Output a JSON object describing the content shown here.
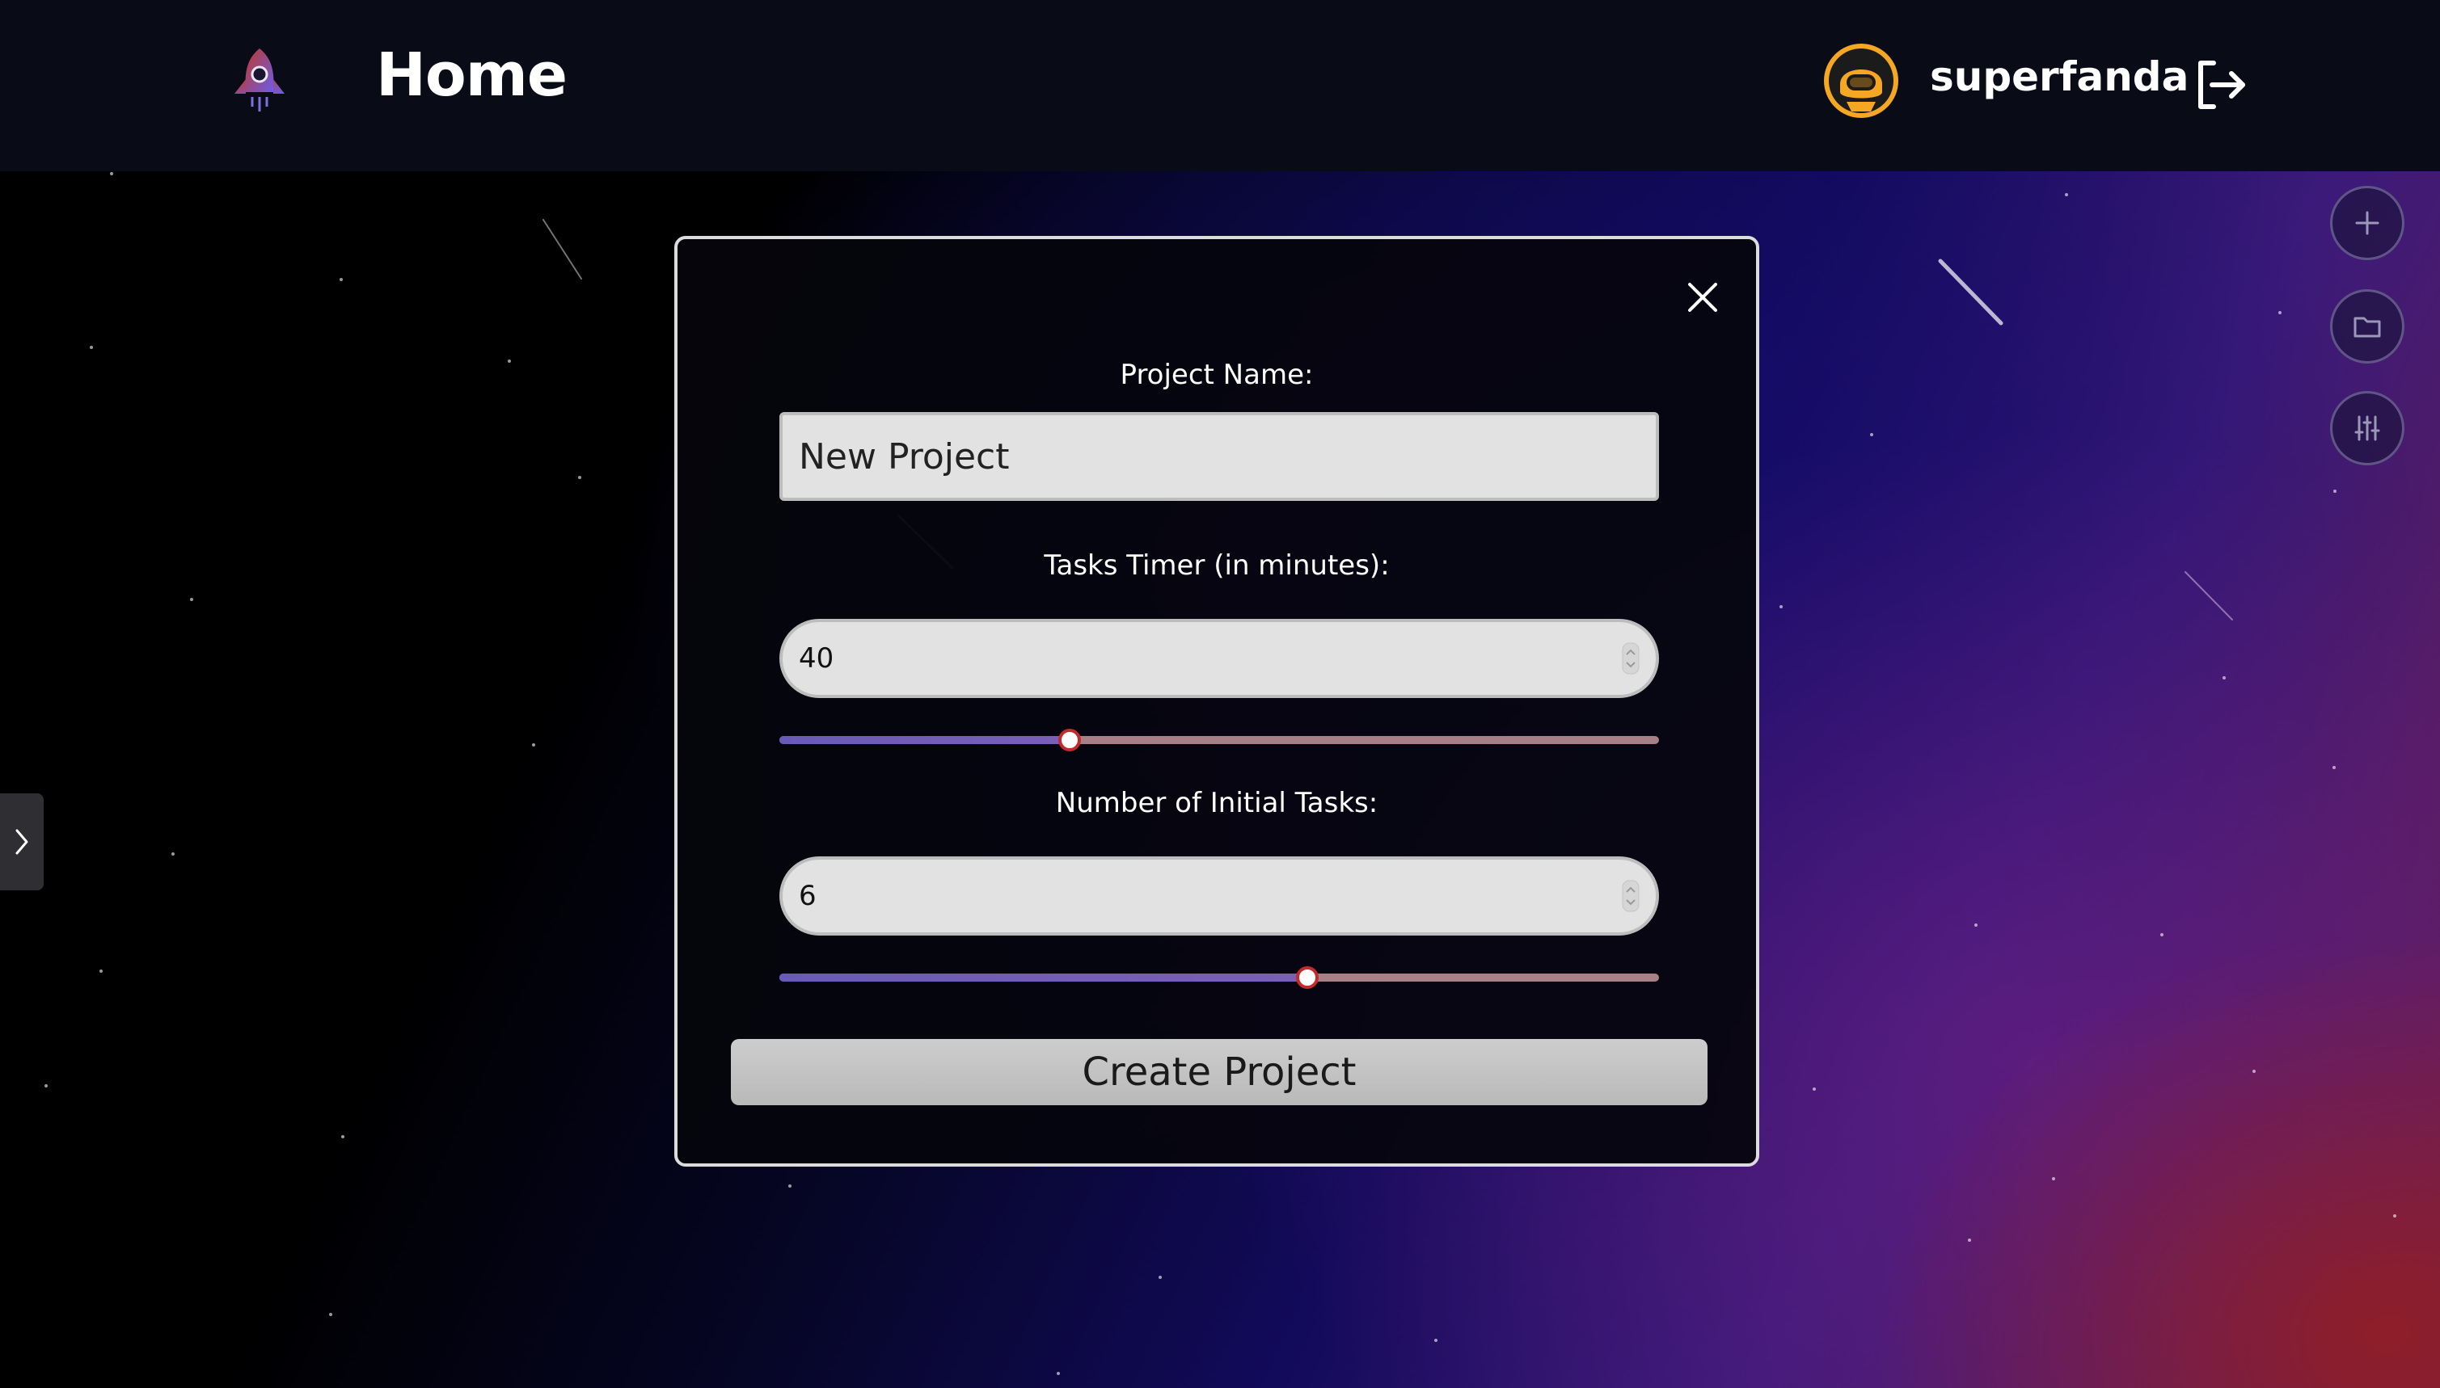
{
  "header": {
    "title": "Home",
    "username": "superfanda",
    "logo_icon": "rocket-icon",
    "avatar_icon": "astronaut-avatar-icon",
    "logout_icon": "logout-icon"
  },
  "side_actions": [
    {
      "icon": "plus-icon"
    },
    {
      "icon": "folder-icon"
    },
    {
      "icon": "sliders-icon"
    }
  ],
  "sidebar_toggle": {
    "icon": "chevron-right-icon"
  },
  "modal": {
    "project_name_label": "Project Name:",
    "project_name_value": "New Project",
    "tasks_timer_label": "Tasks Timer (in minutes):",
    "tasks_timer_value": "40",
    "tasks_timer_slider_fraction": 0.33,
    "initial_tasks_label": "Number of Initial Tasks:",
    "initial_tasks_value": "6",
    "initial_tasks_slider_fraction": 0.6,
    "create_button_label": "Create Project",
    "close_icon": "close-icon"
  },
  "colors": {
    "slider_fill": "#6a5ab8",
    "slider_rest": "#a77f86",
    "thumb_border": "#c22b2b",
    "avatar_orange": "#f5a623"
  }
}
